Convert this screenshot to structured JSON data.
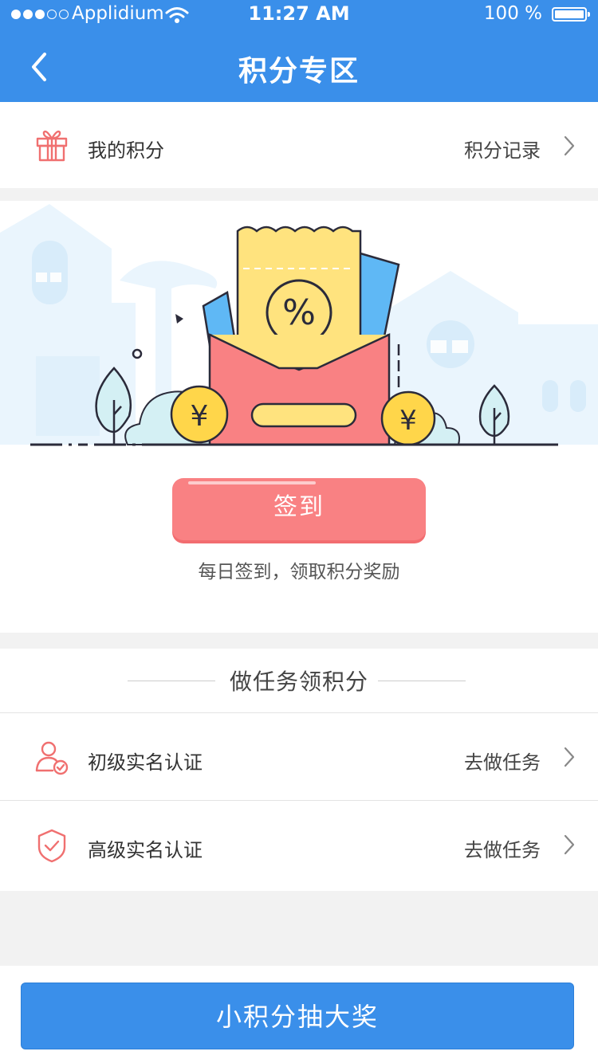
{
  "status_bar": {
    "carrier": "Applidium",
    "time": "11:27 AM",
    "battery": "100 %"
  },
  "nav": {
    "title": "积分专区",
    "back_icon": "chevron-left-icon"
  },
  "points": {
    "label": "我的积分",
    "record_link": "积分记录",
    "icon": "gift-icon"
  },
  "checkin": {
    "button_label": "签到",
    "hint": "每日签到，领取积分奖励",
    "illustration": {
      "percent_symbol": "%",
      "coin_symbol": "¥"
    }
  },
  "tasks": {
    "title": "做任务领积分",
    "items": [
      {
        "label": "初级实名认证",
        "action": "去做任务",
        "icon": "user-check-icon"
      },
      {
        "label": "高级实名认证",
        "action": "去做任务",
        "icon": "shield-check-icon"
      }
    ]
  },
  "bottom": {
    "draw_label": "小积分抽大奖"
  },
  "colors": {
    "primary": "#3a8fea",
    "accent_red": "#f98183",
    "icon_red": "#f07070"
  }
}
